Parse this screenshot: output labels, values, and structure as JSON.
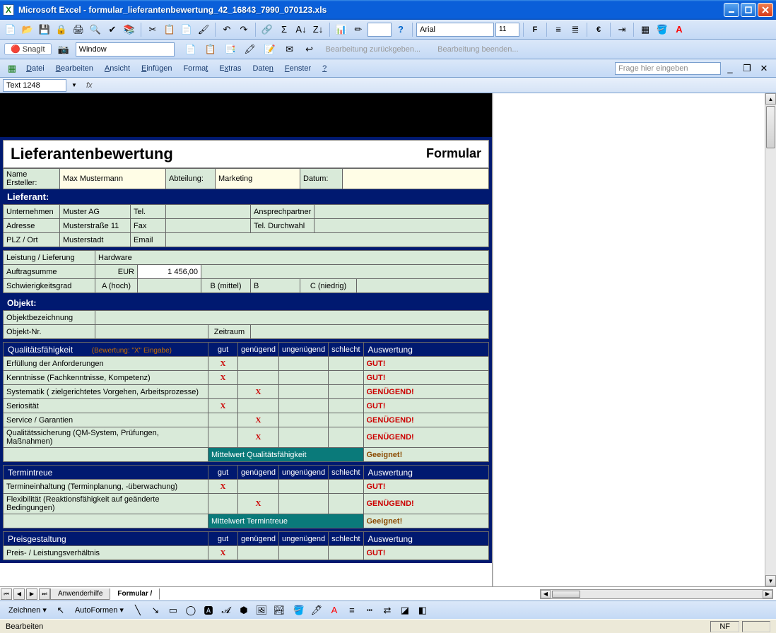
{
  "window": {
    "app": "Microsoft Excel",
    "file": "formular_lieferantenbewertung_42_16843_7990_070123.xls"
  },
  "toolbar1": {
    "font": "Arial",
    "size": "11"
  },
  "snagit": {
    "label": "SnagIt",
    "combo": "Window"
  },
  "toolbar2_gray": {
    "a": "Bearbeitung zurückgeben...",
    "b": "Bearbeitung beenden..."
  },
  "menu": [
    "Datei",
    "Bearbeiten",
    "Ansicht",
    "Einfügen",
    "Format",
    "Extras",
    "Daten",
    "Fenster",
    "?"
  ],
  "questionbox": "Frage hier eingeben",
  "namebox": "Text 1248",
  "form": {
    "title": "Lieferantenbewertung",
    "type": "Formular",
    "meta": {
      "name_label": "Name Ersteller:",
      "name_val": "Max Mustermann",
      "abt_label": "Abteilung:",
      "abt_val": "Marketing",
      "datum_label": "Datum:",
      "datum_val": ""
    },
    "lieferant": {
      "head": "Lieferant:",
      "unternehmen_l": "Unternehmen",
      "unternehmen_v": "Muster AG",
      "tel_l": "Tel.",
      "tel_v": "",
      "ansprech_l": "Ansprechpartner",
      "ansprech_v": "",
      "adresse_l": "Adresse",
      "adresse_v": "Musterstraße 11",
      "fax_l": "Fax",
      "fax_v": "",
      "durch_l": "Tel. Durchwahl",
      "durch_v": "",
      "plz_l": "PLZ / Ort",
      "plz_v": "Musterstadt",
      "email_l": "Email",
      "email_v": ""
    },
    "leistung": {
      "l1": "Leistung / Lieferung",
      "v1": "Hardware",
      "l2": "Auftragsumme",
      "cur": "EUR",
      "v2": "1 456,00",
      "l3": "Schwierigkeitsgrad",
      "a": "A (hoch)",
      "b": "B (mittel)",
      "bv": "B",
      "c": "C (niedrig)"
    },
    "objekt": {
      "head": "Objekt:",
      "l1": "Objektbezeichnung",
      "l2": "Objekt-Nr.",
      "l3": "Zeitraum"
    },
    "rating_scale": {
      "gut": "gut",
      "gen": "genügend",
      "ungen": "ungenügend",
      "schl": "schlecht",
      "ausw": "Auswertung"
    },
    "qual_head": "Qualitätsfähigkeit",
    "qual_hint": "(Bewertung: \"X\" Eingabe)",
    "qual_rows": [
      {
        "label": "Erfüllung der Anforderungen",
        "x": "gut",
        "res": "GUT!"
      },
      {
        "label": "Kenntnisse (Fachkenntnisse, Kompetenz)",
        "x": "gut",
        "res": "GUT!"
      },
      {
        "label": "Systematik ( zielgerichtetes Vorgehen, Arbeitsprozesse)",
        "x": "gen",
        "res": "GENÜGEND!"
      },
      {
        "label": "Seriosität",
        "x": "gut",
        "res": "GUT!"
      },
      {
        "label": "Service / Garantien",
        "x": "gen",
        "res": "GENÜGEND!"
      },
      {
        "label": "Qualitätssicherung (QM-System, Prüfungen, Maßnahmen)",
        "x": "gen",
        "res": "GENÜGEND!"
      }
    ],
    "qual_avg_l": "Mittelwert Qualitätsfähigkeit",
    "qual_avg_v": "Geeignet!",
    "term_head": "Termintreue",
    "term_rows": [
      {
        "label": "Termineinhaltung (Terminplanung, -überwachung)",
        "x": "gut",
        "res": "GUT!"
      },
      {
        "label": "Flexibilität (Reaktionsfähigkeit auf geänderte Bedingungen)",
        "x": "gen",
        "res": "GENÜGEND!"
      }
    ],
    "term_avg_l": "Mittelwert Termintreue",
    "term_avg_v": "Geeignet!",
    "preis_head": "Preisgestaltung",
    "preis_rows": [
      {
        "label": "Preis- / Leistungsverhältnis",
        "x": "gut",
        "res": "GUT!"
      }
    ]
  },
  "tabs": {
    "t1": "Anwenderhilfe",
    "t2": "Formular"
  },
  "drawbar": {
    "zeichnen": "Zeichnen",
    "autoformen": "AutoFormen"
  },
  "status": {
    "mode": "Bearbeiten",
    "nf": "NF"
  }
}
